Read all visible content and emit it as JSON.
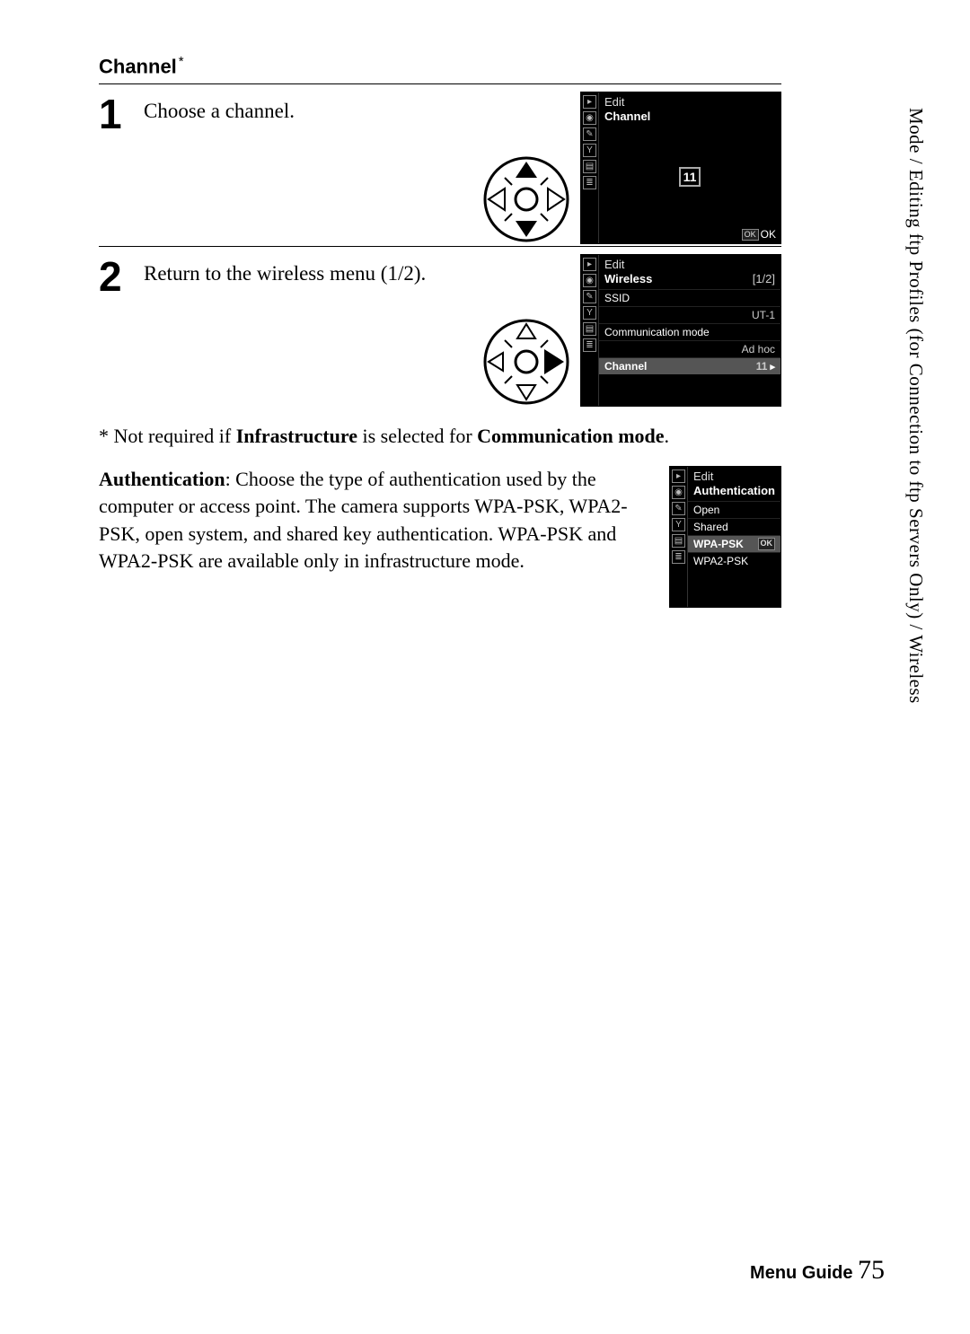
{
  "section": {
    "heading": "Channel",
    "asterisk": "*"
  },
  "steps": [
    {
      "num": "1",
      "text": "Choose a channel."
    },
    {
      "num": "2",
      "text": "Return to the wireless menu (1/2)."
    }
  ],
  "screen_channel": {
    "title": "Edit",
    "subtitle": "Channel",
    "value": "11",
    "ok_badge": "OK",
    "ok_text": "OK"
  },
  "screen_wireless": {
    "title": "Edit",
    "subtitle": "Wireless",
    "page": "[1/2]",
    "rows": [
      {
        "label": "SSID",
        "value": "UT-1"
      },
      {
        "label": "Communication mode",
        "value": "Ad hoc"
      },
      {
        "label": "Channel",
        "value": "11",
        "hl": true,
        "arrow": "▸"
      }
    ]
  },
  "note": {
    "prefix": "* Not required if ",
    "bold1": "Infrastructure",
    "mid": " is selected for ",
    "bold2": "Communication mode",
    "suffix": "."
  },
  "auth": {
    "lead_bold": "Authentication",
    "body": ": Choose the type of authentication used by the computer or access point.  The camera supports WPA-PSK, WPA2-PSK, open system, and shared key authentication.  WPA-PSK and WPA2-PSK are available only in infrastructure mode."
  },
  "screen_auth": {
    "title": "Edit",
    "subtitle": "Authentication",
    "rows": [
      {
        "label": "Open",
        "hl": false
      },
      {
        "label": "Shared",
        "hl": false
      },
      {
        "label": "WPA-PSK",
        "hl": true,
        "ok": "OK"
      },
      {
        "label": "WPA2-PSK",
        "hl": false
      }
    ]
  },
  "side_label": "Mode / Editing ftp Profiles (for Connection to ftp Servers Only) / Wireless",
  "footer": {
    "label": "Menu Guide",
    "page": "75"
  }
}
